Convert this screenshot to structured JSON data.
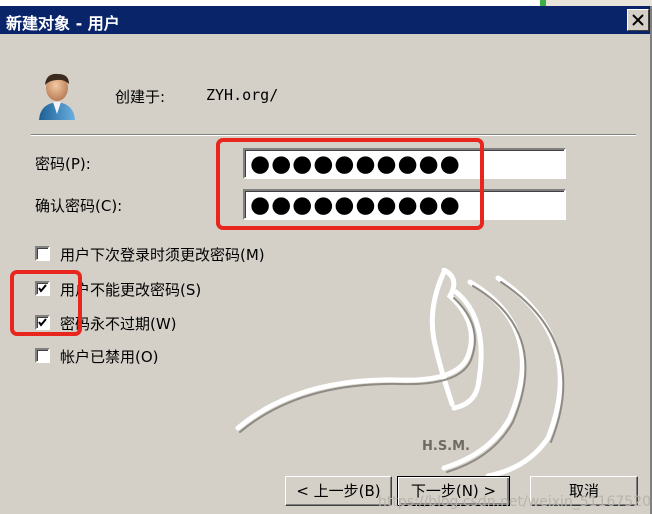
{
  "window": {
    "title": "新建对象 - 用户",
    "close_glyph": "✕"
  },
  "header": {
    "created_in_label": "创建于:",
    "created_in_value": "ZYH.org/",
    "icon": "user-icon"
  },
  "form": {
    "password_label": "密码(P):",
    "password_value": "●●●●●●●●●●",
    "confirm_label": "确认密码(C):",
    "confirm_value": "●●●●●●●●●●"
  },
  "options": [
    {
      "label": "用户下次登录时须更改密码(M)",
      "checked": false
    },
    {
      "label": "用户不能更改密码(S)",
      "checked": true
    },
    {
      "label": "密码永不过期(W)",
      "checked": true
    },
    {
      "label": "帐户已禁用(O)",
      "checked": false
    }
  ],
  "buttons": {
    "back": "< 上一步(B)",
    "next": "下一步(N) >",
    "cancel": "取消"
  },
  "watermark": {
    "text": "https://blog.csdn.net/weixin_51167520",
    "logo_text": "H.S.M."
  },
  "colors": {
    "titlebar": "#0a246a",
    "annotation": "#e8261d",
    "dialog_bg": "#d4d0c8"
  }
}
